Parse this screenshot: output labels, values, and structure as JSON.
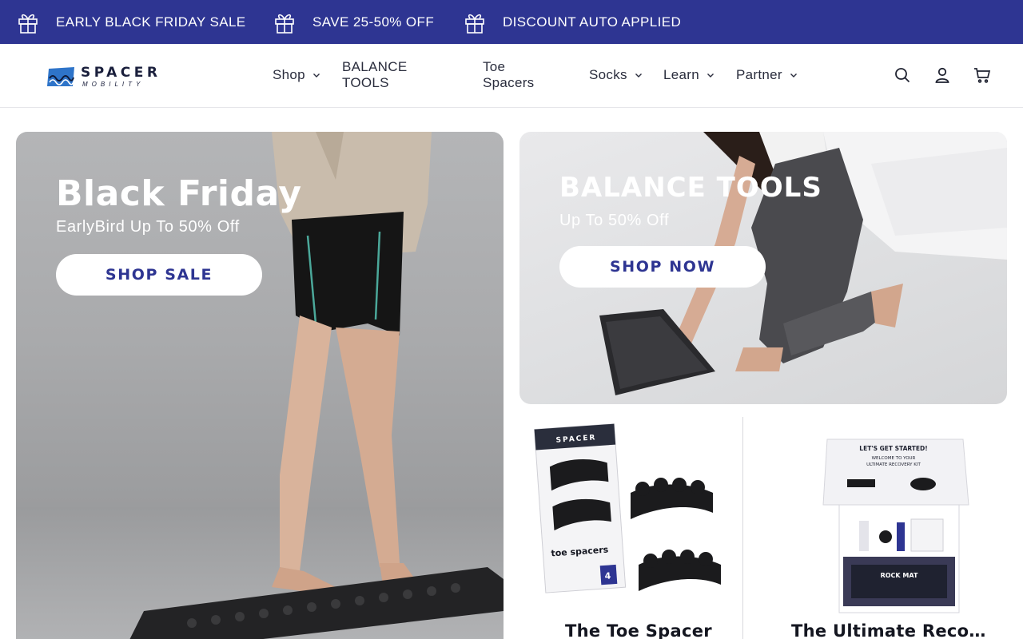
{
  "announcement": {
    "items": [
      {
        "label": "EARLY BLACK FRIDAY SALE",
        "icon": "gift-icon"
      },
      {
        "label": "SAVE 25-50% OFF",
        "icon": "gift-icon"
      },
      {
        "label": "DISCOUNT AUTO APPLIED",
        "icon": "gift-icon"
      }
    ],
    "background": "#2e3592"
  },
  "header": {
    "logo": {
      "word": "SPACER",
      "sub": "MOBILITY"
    },
    "nav": [
      {
        "label": "Shop",
        "has_dropdown": true
      },
      {
        "label": "BALANCE TOOLS",
        "has_dropdown": false
      },
      {
        "label": "Toe Spacers",
        "has_dropdown": false
      },
      {
        "label": "Socks",
        "has_dropdown": true
      },
      {
        "label": "Learn",
        "has_dropdown": true
      },
      {
        "label": "Partner",
        "has_dropdown": true
      }
    ],
    "icons": [
      "search-icon",
      "account-icon",
      "cart-icon"
    ]
  },
  "hero_left": {
    "title": "Black Friday",
    "subtitle": "EarlyBird Up To 50% Off",
    "button": "SHOP SALE"
  },
  "hero_right": {
    "title": "BALANCE TOOLS",
    "subtitle": "Up To 50% Off",
    "button": "SHOP NOW"
  },
  "products": [
    {
      "title": "The Toe Spacer",
      "package_brand": "SPACER",
      "package_text": "toe spacers",
      "package_count": "4"
    },
    {
      "title": "The Ultimate Recove...",
      "box_heading": "LET'S GET STARTED!",
      "box_line1": "WELCOME TO YOUR",
      "box_line2": "ULTIMATE RECOVERY KIT",
      "box_label": "ROCK MAT"
    }
  ],
  "colors": {
    "brand": "#2e3592",
    "text": "#1f2230"
  }
}
